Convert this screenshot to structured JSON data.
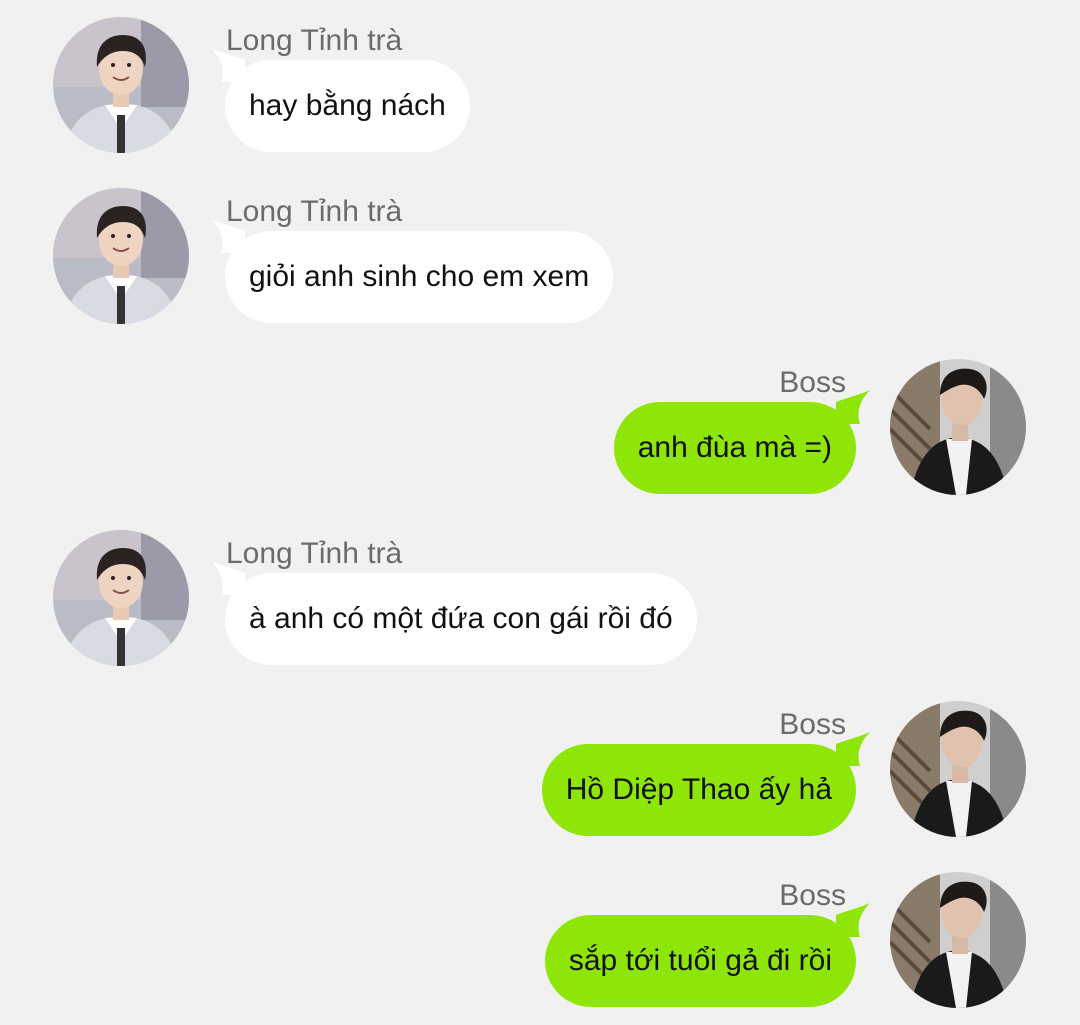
{
  "colors": {
    "background": "#f1f1f1",
    "incoming_bubble": "#ffffff",
    "outgoing_bubble": "#8ee508",
    "sender_name": "#6b6b6b",
    "message_text": "#111111"
  },
  "messages": [
    {
      "direction": "incoming",
      "sender": "Long Tỉnh trà",
      "text": "hay bằng nách",
      "avatar_icon": "young-man-avatar"
    },
    {
      "direction": "incoming",
      "sender": "Long Tỉnh trà",
      "text": "giỏi anh sinh cho em xem",
      "avatar_icon": "young-man-avatar"
    },
    {
      "direction": "outgoing",
      "sender": "Boss",
      "text": "anh đùa mà =)",
      "avatar_icon": "man-in-suit-avatar"
    },
    {
      "direction": "incoming",
      "sender": "Long Tỉnh trà",
      "text": "à anh có một đứa con gái rồi đó",
      "avatar_icon": "young-man-avatar"
    },
    {
      "direction": "outgoing",
      "sender": "Boss",
      "text": "Hồ Diệp Thao ấy hả",
      "avatar_icon": "man-in-suit-avatar"
    },
    {
      "direction": "outgoing",
      "sender": "Boss",
      "text": "sắp tới tuổi gả đi rồi",
      "avatar_icon": "man-in-suit-avatar"
    }
  ]
}
